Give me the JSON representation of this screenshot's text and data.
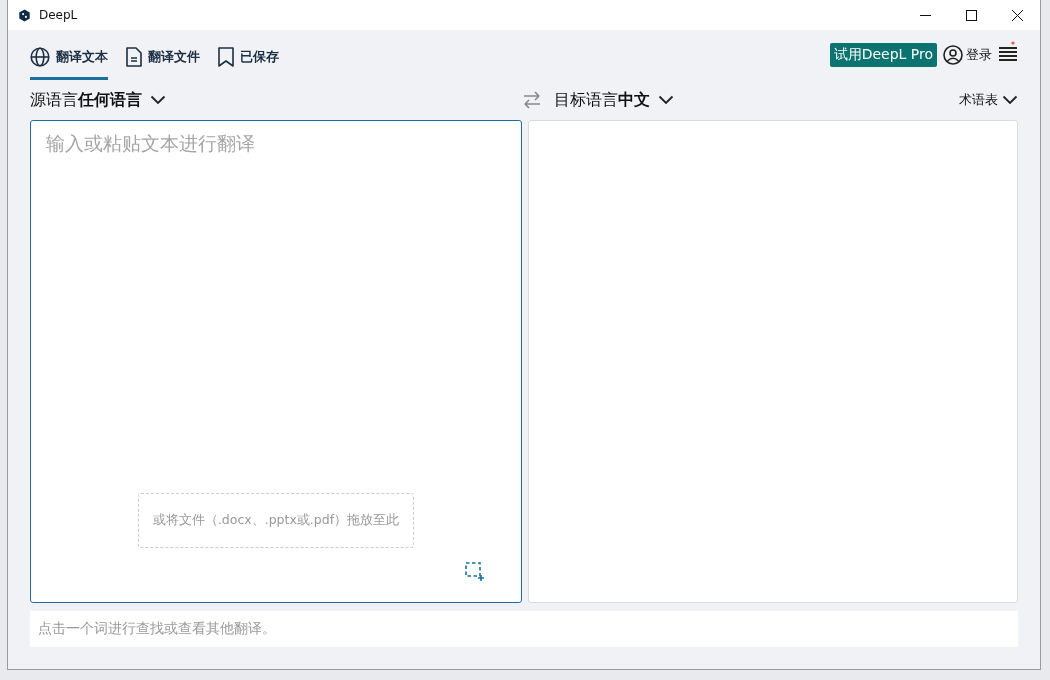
{
  "window": {
    "title": "DeepL"
  },
  "tabs": [
    {
      "label": "翻译文本",
      "selected": true
    },
    {
      "label": "翻译文件",
      "selected": false
    },
    {
      "label": "已保存",
      "selected": false
    }
  ],
  "header": {
    "pro_button": "试用DeepL Pro",
    "login": "登录"
  },
  "source": {
    "language": "源语言**任何语言**",
    "placeholder": "输入或粘贴文本进行翻译",
    "drop_hint": "或将文件（.docx、.pptx或.pdf）拖放至此"
  },
  "target": {
    "language": "目标语言**中文**",
    "glossary": "术语表"
  },
  "status_bar": {
    "hint": "点击一个词进行查找或查看其他翻译。"
  }
}
